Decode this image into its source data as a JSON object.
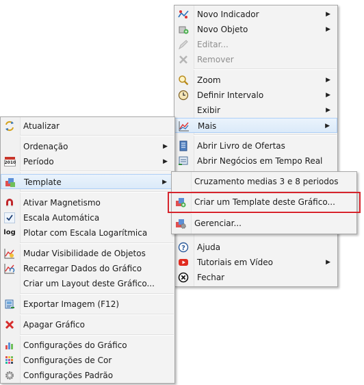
{
  "right_menu": {
    "items": [
      {
        "label": "Novo Indicador",
        "icon": "indicator-icon"
      },
      {
        "label": "Novo Objeto",
        "icon": "object-icon"
      },
      {
        "label": "Editar...",
        "icon": "edit-icon"
      },
      {
        "label": "Remover",
        "icon": "remove-icon"
      },
      {
        "label": "Zoom",
        "icon": "zoom-icon"
      },
      {
        "label": "Definir Intervalo",
        "icon": "clock-icon"
      },
      {
        "label": "Exibir",
        "icon": ""
      },
      {
        "label": "Mais",
        "icon": "chart-icon"
      },
      {
        "label": "Abrir Livro de Ofertas",
        "icon": "book-icon"
      },
      {
        "label": "Abrir Negócios em Tempo Real",
        "icon": "trades-icon"
      },
      {
        "label": "Ajuda",
        "icon": "help-icon"
      },
      {
        "label": "Tutoriais em Vídeo",
        "icon": "video-icon"
      },
      {
        "label": "Fechar",
        "icon": "close-icon"
      }
    ]
  },
  "left_menu": {
    "items": [
      {
        "label": "Atualizar",
        "icon": "refresh-icon"
      },
      {
        "label": "Ordenação",
        "icon": ""
      },
      {
        "label": "Período",
        "icon": "calendar-icon",
        "icon_text": "2010"
      },
      {
        "label": "Template",
        "icon": "template-icon"
      },
      {
        "label": "Ativar Magnetismo",
        "icon": "magnet-icon"
      },
      {
        "label": "Escala Automática",
        "icon": "check-icon"
      },
      {
        "label": "Plotar com Escala Logarítmica",
        "icon": "log-icon",
        "icon_text": "log"
      },
      {
        "label": "Mudar Visibilidade de Objetos",
        "icon": "visibility-icon"
      },
      {
        "label": "Recarregar Dados do Gráfico",
        "icon": "reload-icon"
      },
      {
        "label": "Criar um Layout deste Gráfico...",
        "icon": ""
      },
      {
        "label": "Exportar Imagem (F12)",
        "icon": "export-icon"
      },
      {
        "label": "Apagar Gráfico",
        "icon": "delete-icon"
      },
      {
        "label": "Configurações do Gráfico",
        "icon": "chart-settings-icon"
      },
      {
        "label": "Configurações de Cor",
        "icon": "color-settings-icon"
      },
      {
        "label": "Configurações Padrão",
        "icon": "default-settings-icon"
      }
    ]
  },
  "template_submenu": {
    "items": [
      {
        "label": "Cruzamento medias 3 e 8 periodos",
        "icon": ""
      },
      {
        "label": "Criar um Template deste Gráfico...",
        "icon": "template-add-icon"
      },
      {
        "label": "Gerenciar...",
        "icon": "template-manage-icon"
      }
    ]
  },
  "colors": {
    "highlight_border": "#aecff7",
    "annotation_red": "#d6242c"
  }
}
